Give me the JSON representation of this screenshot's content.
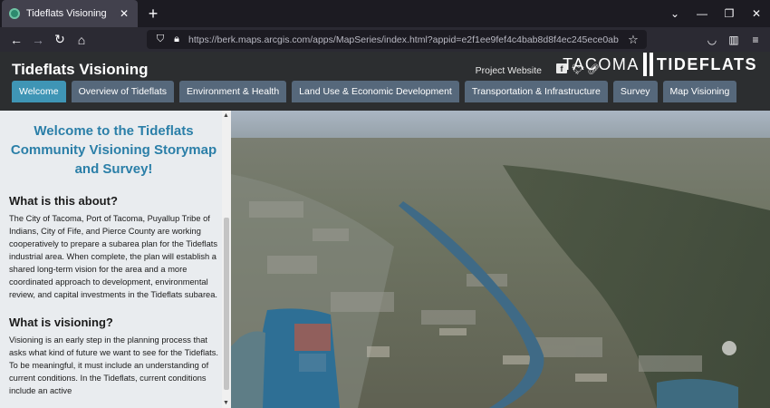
{
  "browser": {
    "tab_title": "Tideflats Visioning",
    "url": "https://berk.maps.arcgis.com/apps/MapSeries/index.html?appid=e2f1ee9fef4c4bab8d8f4ec245ece0ab"
  },
  "app": {
    "title": "Tideflats Visioning",
    "project_link": "Project Website",
    "logo_left": "TACOMA",
    "logo_right": "TIDEFLATS"
  },
  "tabs": [
    {
      "label": "Welcome",
      "active": true
    },
    {
      "label": "Overview of Tideflats",
      "active": false
    },
    {
      "label": "Environment & Health",
      "active": false
    },
    {
      "label": "Land Use & Economic Development",
      "active": false
    },
    {
      "label": "Transportation & Infrastructure",
      "active": false
    },
    {
      "label": "Survey",
      "active": false
    },
    {
      "label": "Map Visioning",
      "active": false
    }
  ],
  "panel": {
    "heading": "Welcome to the Tideflats Community Visioning Storymap and Survey!",
    "section1_title": "What is this about?",
    "section1_text": "The City of Tacoma, Port of Tacoma, Puyallup Tribe of Indians, City of Fife, and Pierce County are working cooperatively to prepare a subarea plan for the Tideflats industrial area. When complete, the plan will establish a shared long-term vision for the area and a more coordinated approach to development, environmental review, and capital investments in the Tideflats subarea.",
    "section2_title": "What is visioning?",
    "section2_text": "Visioning is an early step in the planning process that asks what kind of future we want to see for the Tideflats. To be meaningful, it must include an understanding of current conditions. In the Tideflats, current conditions include an active"
  },
  "colors": {
    "accent": "#3f95b5",
    "tab_bg": "#56687b",
    "header_bg": "#2c2e30",
    "heading": "#2b7fa8"
  }
}
